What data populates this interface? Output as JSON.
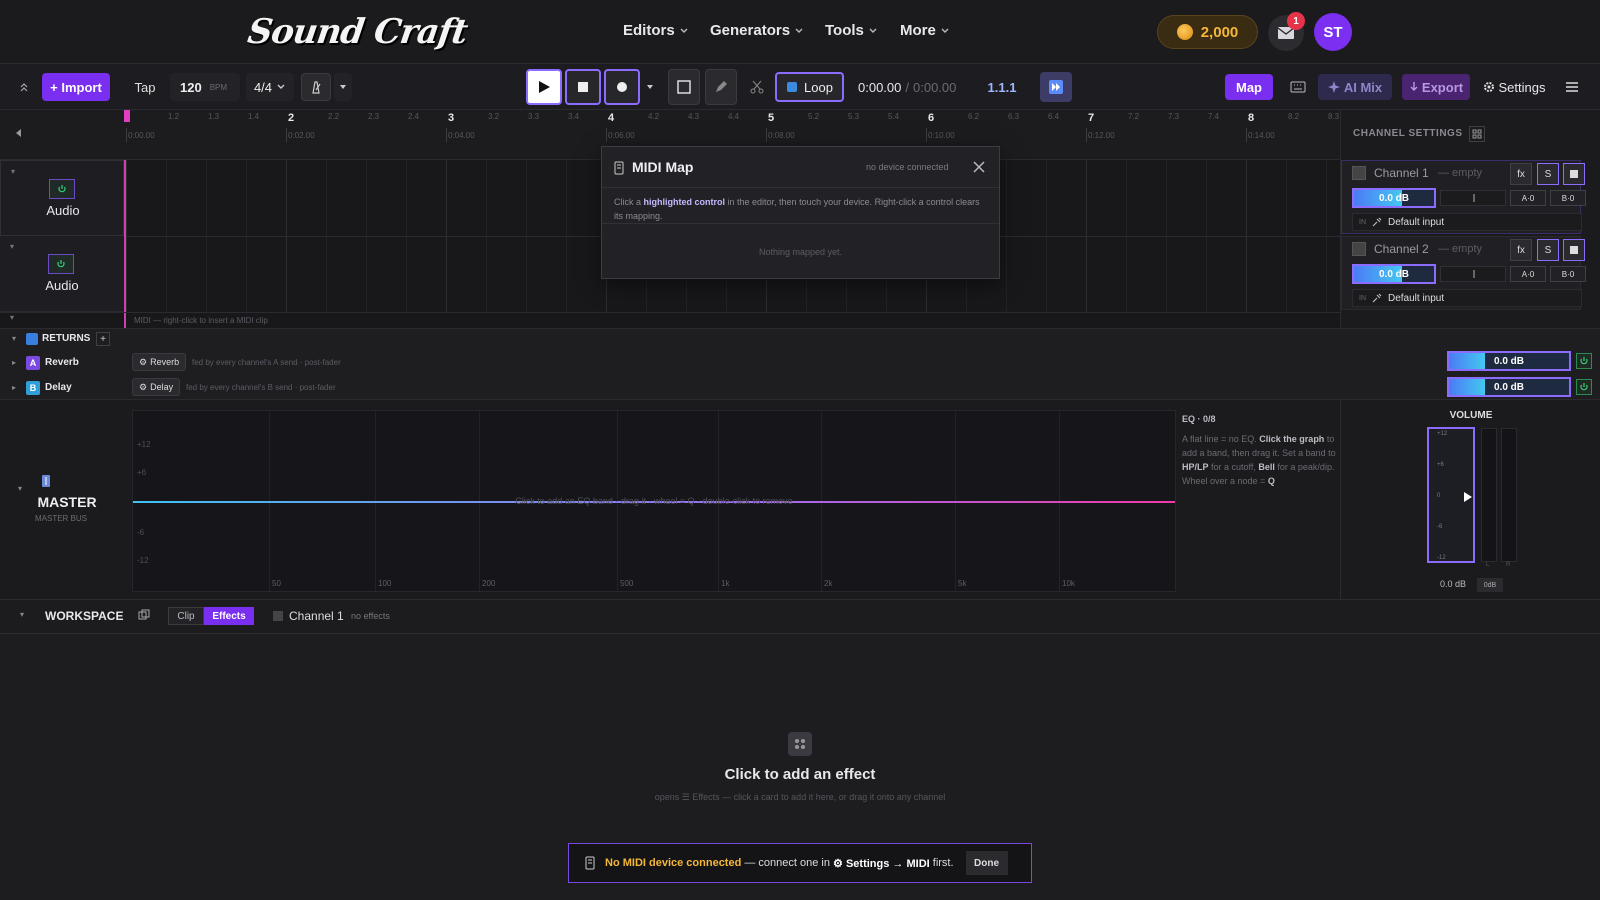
{
  "app": {
    "logo": "Sound Craft",
    "brand_color": "#7a2ef0"
  },
  "nav": {
    "menus": [
      {
        "label": "Editors",
        "icon": "chevron-down-icon"
      },
      {
        "label": "Generators",
        "icon": "chevron-down-icon"
      },
      {
        "label": "Tools",
        "icon": "chevron-down-icon"
      },
      {
        "label": "More",
        "icon": "chevron-down-icon"
      }
    ],
    "coins": "2,000",
    "notifications": "1",
    "avatar": "ST"
  },
  "toolbar": {
    "import": "+ Import",
    "tap": "Tap",
    "bpm": "120",
    "bpm_unit": "BPM",
    "time_sig": "4/4",
    "loop": "Loop",
    "time_current": "0:00.00",
    "time_sep": "/",
    "time_total": "0:00.00",
    "position": "1.1.1",
    "map": "Map",
    "ai_mix": "AI Mix",
    "export": "Export",
    "settings": "Settings"
  },
  "ruler": {
    "bars": [
      "1",
      "2",
      "3",
      "4",
      "5",
      "6",
      "7",
      "8"
    ],
    "subs": [
      [
        "1.2",
        "1.3",
        "1.4"
      ],
      [
        "2.2",
        "2.3",
        "2.4"
      ],
      [
        "3.2",
        "3.3",
        "3.4"
      ],
      [
        "4.2",
        "4.3",
        "4.4"
      ],
      [
        "5.2",
        "5.3",
        "5.4"
      ],
      [
        "6.2",
        "6.3",
        "6.4"
      ],
      [
        "7.2",
        "7.3",
        "7.4"
      ],
      [
        "8.2",
        "8.3"
      ]
    ],
    "times": [
      "0:00.00",
      "0:02.00",
      "0:04.00",
      "0:06.00",
      "0:08.00",
      "0:10.00",
      "0:12.00",
      "0:14.00"
    ]
  },
  "tracks": [
    {
      "name": "Audio"
    },
    {
      "name": "Audio"
    }
  ],
  "midi_hint": "MIDI — right-click to insert a MIDI clip",
  "midi_map": {
    "title": "MIDI Map",
    "status": "no device connected",
    "desc_pre": "Click a ",
    "desc_highlight": "highlighted control",
    "desc_post": " in the editor, then touch your device. Right-click a control clears its mapping.",
    "empty": "Nothing mapped yet."
  },
  "channel_settings": {
    "title": "CHANNEL SETTINGS",
    "channels": [
      {
        "name": "Channel 1",
        "state": "— empty",
        "fx": "fx",
        "solo": "S",
        "db": "0.0 dB",
        "send_a": "A·0",
        "send_b": "B·0",
        "in_label": "IN",
        "input": "Default input"
      },
      {
        "name": "Channel 2",
        "state": "— empty",
        "fx": "fx",
        "solo": "S",
        "db": "0.0 dB",
        "send_a": "A·0",
        "send_b": "B·0",
        "in_label": "IN",
        "input": "Default input"
      }
    ]
  },
  "returns": {
    "title": "RETURNS",
    "add": "+",
    "items": [
      {
        "letter": "A",
        "name": "Reverb",
        "chip": "Reverb",
        "desc": "fed by every channel's A send · post-fader",
        "db": "0.0 dB",
        "color": "#7a4ae0"
      },
      {
        "letter": "B",
        "name": "Delay",
        "chip": "Delay",
        "desc": "fed by every channel's B send · post-fader",
        "db": "0.0 dB",
        "color": "#2e9fd8"
      }
    ]
  },
  "master": {
    "title": "MASTER",
    "subtitle": "MASTER BUS",
    "eq_y_labels": [
      "+12",
      "+6",
      "-6",
      "-12"
    ],
    "eq_x_labels": [
      "50",
      "100",
      "200",
      "500",
      "1k",
      "2k",
      "5k",
      "10k"
    ],
    "eq_hint": "Click to add an EQ band · drag it · wheel = Q · double-click to remove",
    "eq_title": "EQ · 0/8",
    "eq_note_1": "A flat line = no EQ. ",
    "eq_note_2": "Click the graph",
    "eq_note_3": " to add a band, then drag it. Set a band to ",
    "eq_note_4": "HP/LP",
    "eq_note_5": " for a cutoff, ",
    "eq_note_6": "Bell",
    "eq_note_7": " for a peak/dip. Wheel over a node = ",
    "eq_note_8": "Q",
    "volume_title": "VOLUME",
    "vol_ticks": [
      "+12",
      "+6",
      "0",
      "-6",
      "-12"
    ],
    "vol_meter_l": "L",
    "vol_meter_r": "R",
    "vol_db": "0.0 dB",
    "vol_btn": "0dB"
  },
  "workspace": {
    "title": "WORKSPACE",
    "tab_clip": "Clip",
    "tab_effects": "Effects",
    "channel": "Channel 1",
    "channel_state": "no effects",
    "empty_title": "Click to add an effect",
    "empty_desc": "opens ☰ Effects — click a card to add it here, or drag it onto any channel"
  },
  "toast": {
    "bold": "No MIDI device connected",
    "mid": " — connect one in ",
    "settings": "⚙ Settings → MIDI",
    "end": " first.",
    "done": "Done"
  }
}
